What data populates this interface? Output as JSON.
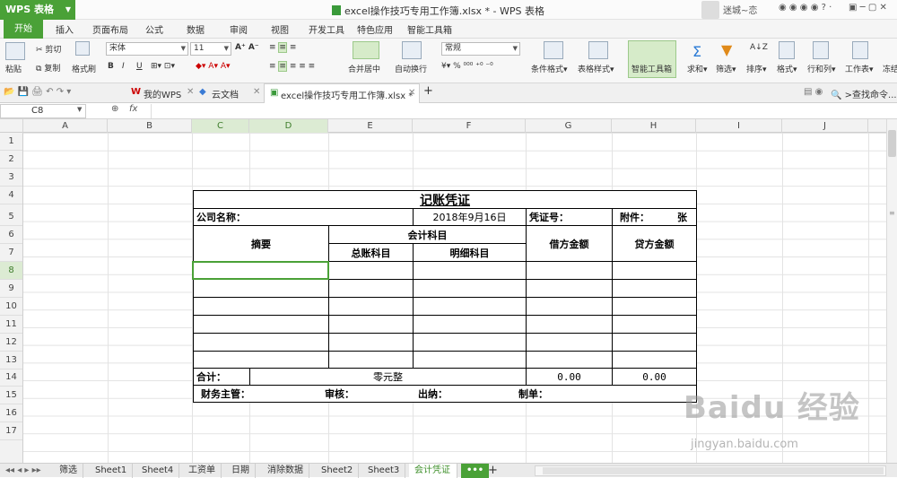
{
  "app": {
    "name": "WPS 表格",
    "doc_title": "excel操作技巧专用工作簿.xlsx * - WPS 表格",
    "user": "迷城~恋"
  },
  "ribbon_tabs": [
    "开始",
    "插入",
    "页面布局",
    "公式",
    "数据",
    "审阅",
    "视图",
    "开发工具",
    "特色应用",
    "智能工具箱"
  ],
  "ribbon": {
    "paste": "粘贴",
    "cut": "剪切",
    "copy": "复制",
    "format_painter": "格式刷",
    "font_name": "宋体",
    "font_size": "11",
    "merge_center": "合并居中",
    "wrap_text": "自动换行",
    "number_format": "常规",
    "conditional_format": "条件格式",
    "table_style": "表格样式",
    "smart_toolbox": "智能工具箱",
    "sum": "求和",
    "filter": "筛选",
    "sort": "排序",
    "format": "格式",
    "row_col": "行和列",
    "worksheet": "工作表",
    "freeze": "冻结"
  },
  "doc_tabs": {
    "my_wps": "我的WPS",
    "cloud_docs": "云文档",
    "active": "excel操作技巧专用工作簿.xlsx *",
    "find": "查找命令..."
  },
  "formula_bar": {
    "cell_ref": "C8",
    "fx": "fx",
    "value": ""
  },
  "columns": [
    "A",
    "B",
    "C",
    "D",
    "E",
    "F",
    "G",
    "H",
    "I",
    "J"
  ],
  "rows": [
    "1",
    "2",
    "3",
    "4",
    "5",
    "6",
    "7",
    "8",
    "9",
    "10",
    "11",
    "12",
    "13",
    "14",
    "15",
    "16",
    "17"
  ],
  "voucher": {
    "title": "记账凭证",
    "company_label": "公司名称：",
    "date": "2018年9月16日",
    "voucher_no_label": "凭证号：",
    "attachment_label": "附件：",
    "attachment_unit": "张",
    "summary": "摘要",
    "account": "会计科目",
    "general_account": "总账科目",
    "detail_account": "明细科目",
    "debit": "借方金额",
    "credit": "贷方金额",
    "total_label": "合计：",
    "total_cn": "零元整",
    "debit_total": "0.00",
    "credit_total": "0.00",
    "manager_label": "财务主管：",
    "review_label": "审核：",
    "cashier_label": "出纳：",
    "maker_label": "制单："
  },
  "sheets": [
    "筛选",
    "Sheet1",
    "Sheet4",
    "工资单",
    "日期",
    "消除数据",
    "Sheet2",
    "Sheet3",
    "会计凭证"
  ],
  "active_sheet": "会计凭证",
  "watermark": {
    "brand": "Baidu 经验",
    "url": "jingyan.baidu.com"
  },
  "colors": {
    "accent": "#4aa137",
    "selection": "#4aa137"
  }
}
